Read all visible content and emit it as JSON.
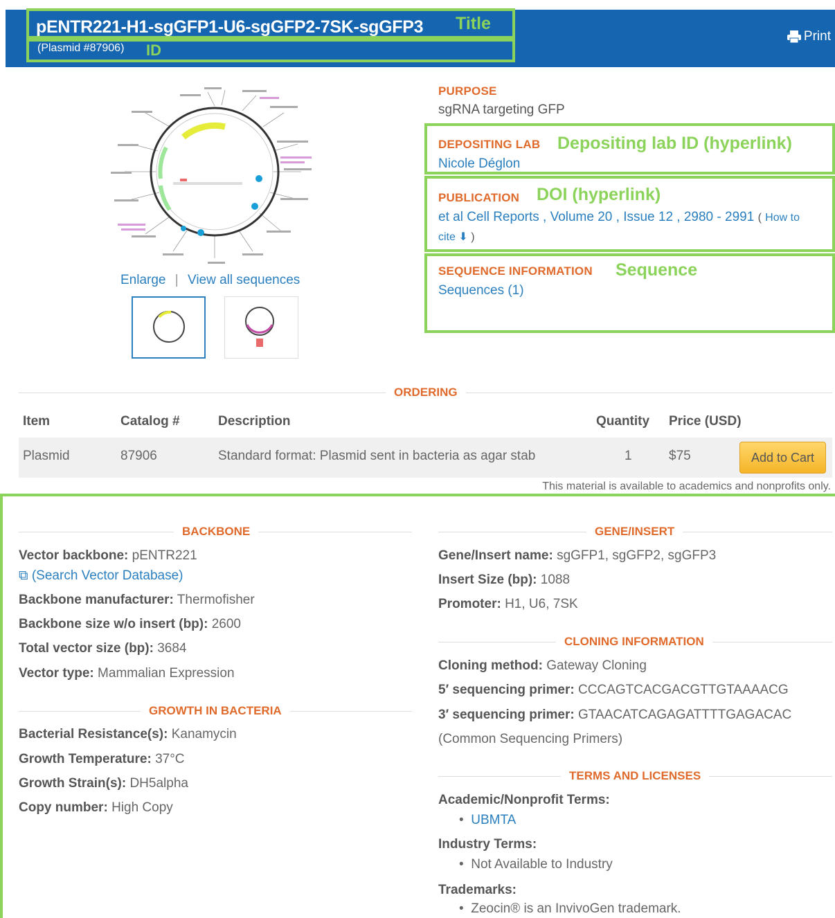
{
  "header": {
    "title": "pENTR221-H1-sgGFP1-U6-sgGFP2-7SK-sgGFP3",
    "plasmid_id": "(Plasmid #87906)",
    "print_label": "Print"
  },
  "annotations": {
    "title": "Title",
    "id": "ID",
    "depositing_lab": "Depositing lab ID (hyperlink)",
    "publication": "DOI (hyperlink)",
    "sequence": "Sequence"
  },
  "map": {
    "enlarge": "Enlarge",
    "separator": "|",
    "view_all": "View all sequences"
  },
  "info": {
    "purpose_label": "PURPOSE",
    "purpose_value": "sgRNA targeting GFP",
    "lab_label": "DEPOSITING LAB",
    "lab_value": "Nicole Déglon",
    "publication_label": "PUBLICATION",
    "publication_value": "et al Cell Reports , Volume 20 , Issue 12 , 2980 - 2991",
    "how_to_cite_open": "(",
    "how_to_cite": "How to",
    "cite": "cite",
    "cite_close": ")",
    "sequence_label": "SEQUENCE INFORMATION",
    "sequence_value": "Sequences (1)"
  },
  "ordering": {
    "heading": "ORDERING",
    "columns": {
      "item": "Item",
      "catalog": "Catalog #",
      "description": "Description",
      "quantity": "Quantity",
      "price": "Price (USD)"
    },
    "row": {
      "item": "Plasmid",
      "catalog": "87906",
      "description": "Standard format: Plasmid sent in bacteria as agar stab",
      "quantity": "1",
      "price": "$75"
    },
    "add_to_cart": "Add to Cart",
    "note": "This material is available to academics and nonprofits only."
  },
  "backbone": {
    "heading": "BACKBONE",
    "vector_backbone_label": "Vector backbone:",
    "vector_backbone_value": "pENTR221",
    "search_link": "(Search Vector Database)",
    "manufacturer_label": "Backbone manufacturer:",
    "manufacturer_value": "Thermofisher",
    "size_label": "Backbone size w/o insert (bp):",
    "size_value": "2600",
    "total_label": "Total vector size (bp):",
    "total_value": "3684",
    "type_label": "Vector type:",
    "type_value": "Mammalian Expression"
  },
  "growth": {
    "heading": "GROWTH IN BACTERIA",
    "resistance_label": "Bacterial Resistance(s):",
    "resistance_value": "Kanamycin",
    "temp_label": "Growth Temperature:",
    "temp_value": "37°C",
    "strain_label": "Growth Strain(s):",
    "strain_value": "DH5alpha",
    "copy_label": "Copy number:",
    "copy_value": "High Copy"
  },
  "gene": {
    "heading": "GENE/INSERT",
    "name_label": "Gene/Insert name:",
    "name_value": "sgGFP1, sgGFP2, sgGFP3",
    "size_label": "Insert Size (bp):",
    "size_value": "1088",
    "promoter_label": "Promoter:",
    "promoter_value": "H1, U6, 7SK"
  },
  "cloning": {
    "heading": "CLONING INFORMATION",
    "method_label": "Cloning method:",
    "method_value": "Gateway Cloning",
    "primer5_label": "5′ sequencing primer:",
    "primer5_value": "CCCAGTCACGACGTTGTAAAACG",
    "primer3_label": "3′ sequencing primer:",
    "primer3_value": "GTAACATCAGAGATTTTGAGACAC",
    "common_link": "(Common Sequencing Primers)"
  },
  "terms": {
    "heading": "TERMS AND LICENSES",
    "academic_label": "Academic/Nonprofit Terms:",
    "academic_item": "UBMTA",
    "industry_label": "Industry Terms:",
    "industry_item": "Not Available to Industry",
    "trademarks_label": "Trademarks:",
    "trademarks_item": "Zeocin® is an InvivoGen trademark."
  },
  "colors": {
    "header": "#1565b0",
    "annotation": "#8bd35a",
    "section": "#e06a2b",
    "link": "#2a7fbf",
    "button": "#f5b428"
  }
}
